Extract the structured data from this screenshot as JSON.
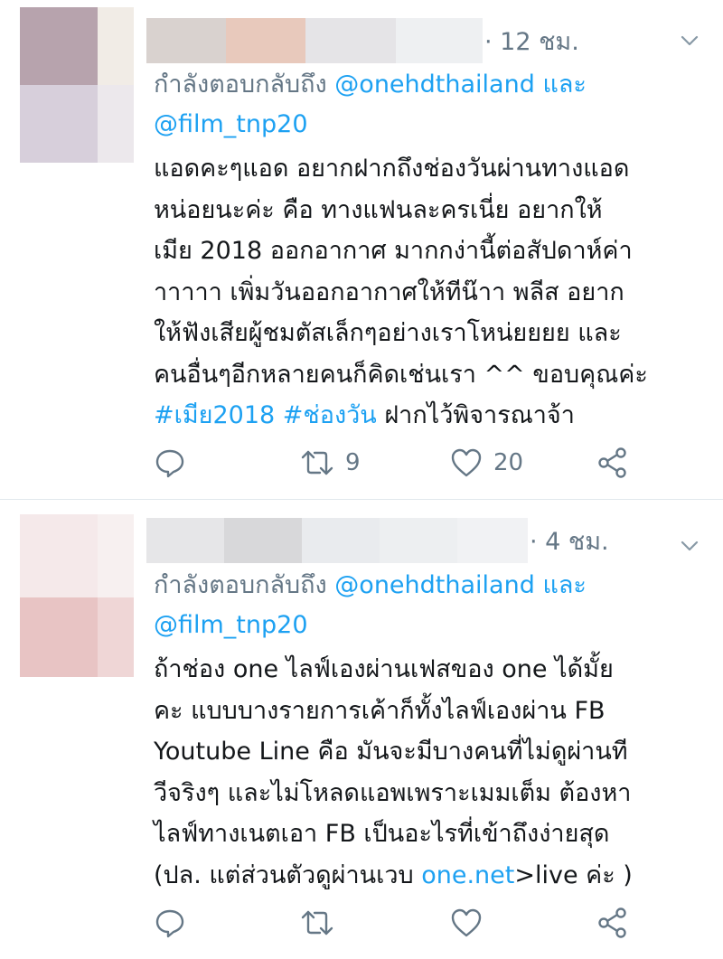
{
  "tweets": [
    {
      "time": "· 12 ชม.",
      "reply_prefix": "กำลังตอบกลับถึง",
      "mention_1": "@onehdthailand",
      "and_word": "และ",
      "mention_2": "@film_tnp20",
      "lines": [
        "แอดคะๆแอด อยากฝากถึงช่องวันผ่านทางแอด",
        "หน่อยนะค่ะ คือ ทางแฟนละครเนี่ย อยากให้",
        "เมีย 2018 ออกอากาศ มากกง่านี้ต่อสัปดาห์ค่า",
        "าาาาา เพิ่มวันออกอากาศให้ทีน๊าา พลีส อยาก",
        "ให้ฟังเสียผู้ชมตัสเล็กๆอย่างเราโหน่ยยยย และ",
        "คนอื่นๆอีกหลายคนก็คิดเช่นเรา ^^ ขอบคุณค่ะ"
      ],
      "hashtag_1": "#เมีย2018",
      "hashtag_2": "#ช่องวัน",
      "last_line_rest": "ฝากไว้พิจารณาจ้า",
      "retweets": "9",
      "likes": "20"
    },
    {
      "time": "· 4 ชม.",
      "reply_prefix": "กำลังตอบกลับถึง",
      "mention_1": "@onehdthailand",
      "and_word": "และ",
      "mention_2": "@film_tnp20",
      "lines": [
        "ถ้าช่อง one ไลฟ์เองผ่านเฟสของ one ได้มั้ย",
        "คะ แบบบางรายการเค้าก็ทั้งไลฟ์เองผ่าน FB",
        "Youtube Line คือ มันจะมีบางคนที่ไม่ดูผ่านที",
        "วีจริงๆ และไม่โหลดแอพเพราะเมมเต็ม ต้องหา",
        "ไลฟ์ทางเนตเอา FB เป็นอะไรที่เข้าถึงง่ายสุด"
      ],
      "last_line_pre": "(ปล. แต่ส่วนตัวดูผ่านเวบ",
      "last_line_link": "one.net",
      "last_line_post": ">live ค่ะ )",
      "retweets": "",
      "likes": ""
    }
  ],
  "colors": {
    "accent": "#1da1f2",
    "muted": "#657786",
    "text": "#14171a",
    "divider": "#e1e8ed"
  },
  "icons": [
    "reply-icon",
    "retweet-icon",
    "like-icon",
    "share-icon",
    "chevron-down-icon"
  ]
}
